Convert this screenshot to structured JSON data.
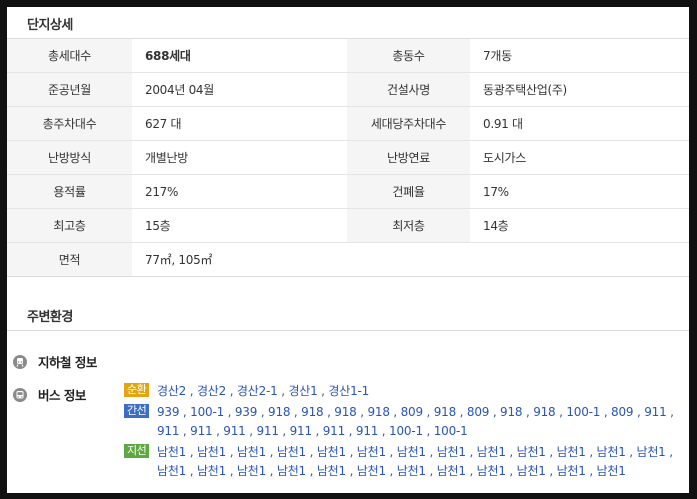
{
  "complex": {
    "title": "단지상세",
    "rows": [
      [
        "총세대수",
        "688세대",
        "총동수",
        "7개동"
      ],
      [
        "준공년월",
        "2004년 04월",
        "건설사명",
        "동광주택산업(주)"
      ],
      [
        "총주차대수",
        "627 대",
        "세대당주차대수",
        "0.91 대"
      ],
      [
        "난방방식",
        "개별난방",
        "난방연료",
        "도시가스"
      ],
      [
        "용적률",
        "217%",
        "건폐율",
        "17%"
      ],
      [
        "최고층",
        "15층",
        "최저층",
        "14층"
      ],
      [
        "면적",
        "77㎡, 105㎡",
        "",
        ""
      ]
    ]
  },
  "surroundings": {
    "title": "주변환경",
    "subway": {
      "label": "지하철 정보"
    },
    "bus": {
      "label": "버스 정보",
      "groups": [
        {
          "badge": "순환",
          "color": "#e3a512",
          "routes": "경산2 , 경산2 , 경산2-1 , 경산1 , 경산1-1"
        },
        {
          "badge": "간선",
          "color": "#3b6fc5",
          "routes": "939 , 100-1 , 939 , 918 , 918 , 918 , 918 , 809 , 918 , 809 , 918 , 918 , 100-1 , 809 , 911 , 911 , 911 , 911 , 911 , 911 , 911 , 911 , 100-1 , 100-1"
        },
        {
          "badge": "지선",
          "color": "#5ea93f",
          "routes": "남천1 , 남천1 , 남천1 , 남천1 , 남천1 , 남천1 , 남천1 , 남천1 , 남천1 , 남천1 , 남천1 , 남천1 , 남천1 , 남천1 , 남천1 , 남천1 , 남천1 , 남천1 , 남천1 , 남천1 , 남천1 , 남천1 , 남천1 , 남천1 , 남천1"
        }
      ]
    }
  },
  "colors": {
    "accent": "#3b67c8",
    "link": "#2a55b5"
  }
}
